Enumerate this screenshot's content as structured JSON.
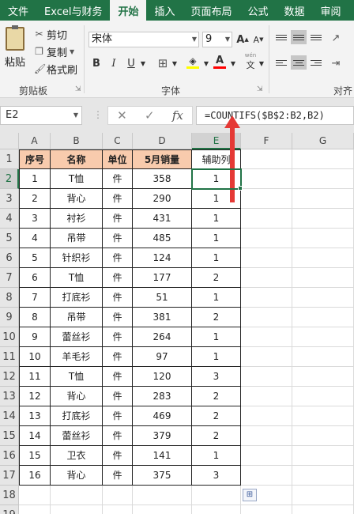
{
  "ribbon": {
    "tabs": [
      "文件",
      "Excel与财务",
      "开始",
      "插入",
      "页面布局",
      "公式",
      "数据",
      "审阅"
    ],
    "active_tab": "开始",
    "clipboard": {
      "paste": "粘贴",
      "cut": "剪切",
      "copy": "复制",
      "format_painter": "格式刷",
      "group": "剪贴板"
    },
    "font": {
      "name": "宋体",
      "size": "9",
      "group": "字体",
      "grow": "A",
      "shrink": "A",
      "bold": "B",
      "italic": "I",
      "underline": "U",
      "font_color": "A",
      "phonetic": "文"
    },
    "alignment": {
      "group": "对齐"
    }
  },
  "formula_bar": {
    "name_box": "E2",
    "cancel": "✕",
    "enter": "✓",
    "fx": "fx",
    "formula": "=COUNTIFS($B$2:B2,B2)"
  },
  "grid": {
    "columns": [
      "A",
      "B",
      "C",
      "D",
      "E",
      "F",
      "G"
    ],
    "rows": [
      "1",
      "2",
      "3",
      "4",
      "5",
      "6",
      "7",
      "8",
      "9",
      "10",
      "11",
      "12",
      "13",
      "14",
      "15",
      "16",
      "17",
      "18",
      "19"
    ],
    "selected_cell": "E2",
    "headers": [
      "序号",
      "名称",
      "单位",
      "5月销量",
      "辅助列"
    ],
    "records": [
      [
        "1",
        "T恤",
        "件",
        "358",
        "1"
      ],
      [
        "2",
        "背心",
        "件",
        "290",
        "1"
      ],
      [
        "3",
        "衬衫",
        "件",
        "431",
        "1"
      ],
      [
        "4",
        "吊带",
        "件",
        "485",
        "1"
      ],
      [
        "5",
        "针织衫",
        "件",
        "124",
        "1"
      ],
      [
        "6",
        "T恤",
        "件",
        "177",
        "2"
      ],
      [
        "7",
        "打底衫",
        "件",
        "51",
        "1"
      ],
      [
        "8",
        "吊带",
        "件",
        "381",
        "2"
      ],
      [
        "9",
        "蕾丝衫",
        "件",
        "264",
        "1"
      ],
      [
        "10",
        "羊毛衫",
        "件",
        "97",
        "1"
      ],
      [
        "11",
        "T恤",
        "件",
        "120",
        "3"
      ],
      [
        "12",
        "背心",
        "件",
        "283",
        "2"
      ],
      [
        "13",
        "打底衫",
        "件",
        "469",
        "2"
      ],
      [
        "14",
        "蕾丝衫",
        "件",
        "379",
        "2"
      ],
      [
        "15",
        "卫衣",
        "件",
        "141",
        "1"
      ],
      [
        "16",
        "背心",
        "件",
        "375",
        "3"
      ]
    ]
  },
  "colors": {
    "excel_green": "#217346",
    "header_fill": "#f8cbad",
    "arrow_red": "#e53935"
  }
}
